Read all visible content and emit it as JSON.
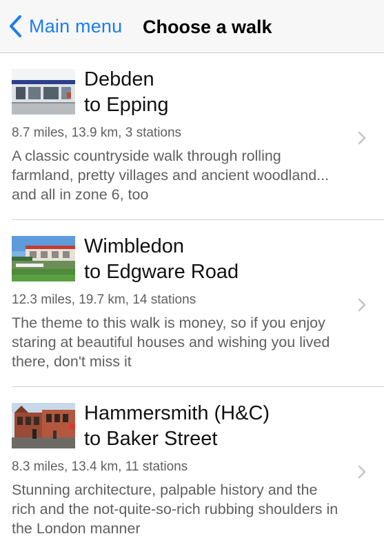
{
  "nav": {
    "back_label": "Main menu",
    "title": "Choose a walk",
    "back_icon": "chevron-left-icon",
    "accent_color": "#1a7df1"
  },
  "walks": [
    {
      "name_line1": "Debden",
      "name_line2": "to Epping",
      "meta": "8.7 miles, 13.9 km, 3 stations",
      "description": "A classic countryside walk through rolling farmland, pretty villages and ancient woodland... and all in zone 6, too"
    },
    {
      "name_line1": "Wimbledon",
      "name_line2": "to Edgware Road",
      "meta": "12.3 miles, 19.7 km, 14 stations",
      "description": "The theme to this walk is money, so if you enjoy staring at beautiful houses and wishing you lived there, don't miss it"
    },
    {
      "name_line1": "Hammersmith (H&C)",
      "name_line2": "to Baker Street",
      "meta": "8.3 miles, 13.4 km, 11 stations",
      "description": "Stunning architecture, palpable history and the rich and the not-quite-so-rich rubbing shoulders in the London manner"
    }
  ]
}
